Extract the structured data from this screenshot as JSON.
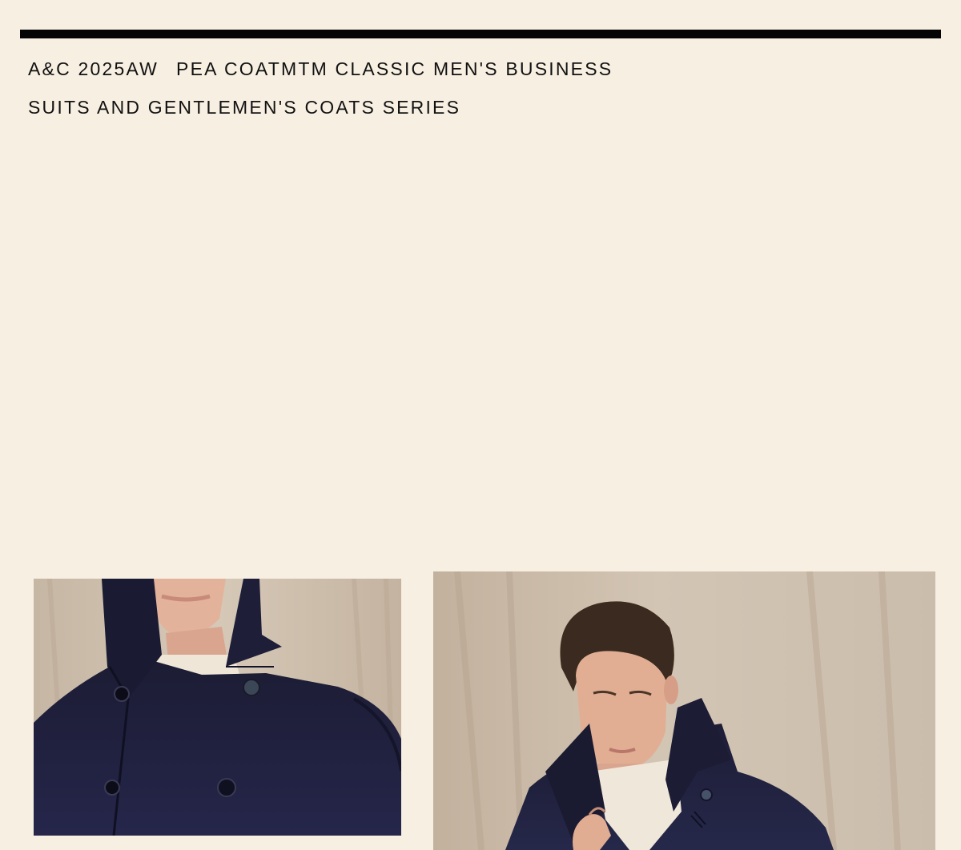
{
  "header": {
    "brand": "A&C 2025AW",
    "title_line1": "PEA COATMTM CLASSIC MEN'S BUSINESS",
    "title_line2": "SUITS AND GENTLEMEN'S COATS SERIES"
  },
  "colors": {
    "background": "#f7efe2",
    "rule": "#050505",
    "text": "#111111",
    "coat_navy": "#20203a",
    "backdrop": "#cbbcab"
  },
  "images": [
    {
      "name": "coat-collar-closeup-photo"
    },
    {
      "name": "model-in-pea-coat-photo"
    }
  ]
}
